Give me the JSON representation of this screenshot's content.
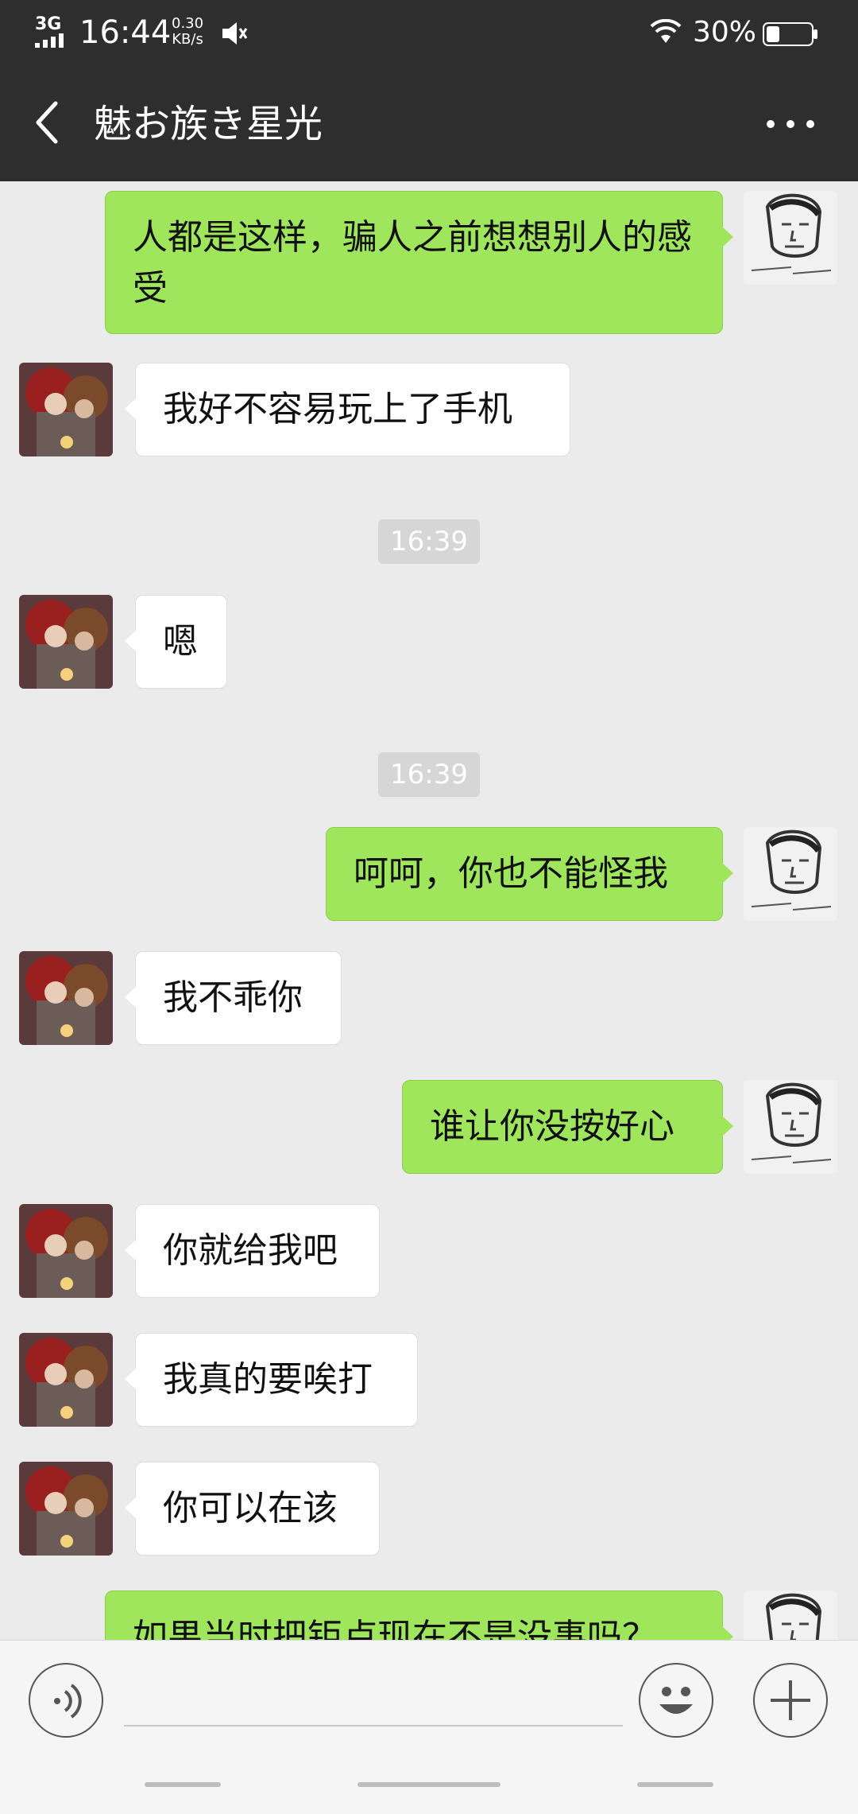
{
  "status_bar": {
    "network": "3G",
    "time": "16:44",
    "speed_value": "0.30",
    "speed_unit": "KB/s",
    "battery_percent": "30%",
    "battery_level": 0.3
  },
  "header": {
    "title": "魅お族き星光",
    "back_icon": "chevron-left-icon",
    "more_icon": "more-dots-icon"
  },
  "chat": {
    "messages": [
      {
        "side": "right",
        "text": "人都是这样，骗人之前想想别人的感受"
      },
      {
        "side": "left",
        "text": "我好不容易玩上了手机"
      },
      {
        "type": "time",
        "text": "16:39"
      },
      {
        "side": "left",
        "text": "嗯"
      },
      {
        "type": "time",
        "text": "16:39"
      },
      {
        "side": "right",
        "text": "呵呵，你也不能怪我"
      },
      {
        "side": "left",
        "text": "我不乖你"
      },
      {
        "side": "right",
        "text": "谁让你没按好心"
      },
      {
        "side": "left",
        "text": "你就给我吧"
      },
      {
        "side": "left",
        "text": "我真的要唉打"
      },
      {
        "side": "left",
        "text": "你可以在该"
      },
      {
        "side": "right",
        "text": "如果当时把钜卢现在不是没事吗？"
      }
    ]
  },
  "input_bar": {
    "voice_icon": "voice-icon",
    "emoji_icon": "emoji-icon",
    "plus_icon": "plus-icon",
    "placeholder": ""
  },
  "colors": {
    "header_bg": "#2e2e2e",
    "chat_bg": "#ebebeb",
    "bubble_self": "#9fe65c",
    "bubble_other": "#ffffff"
  }
}
